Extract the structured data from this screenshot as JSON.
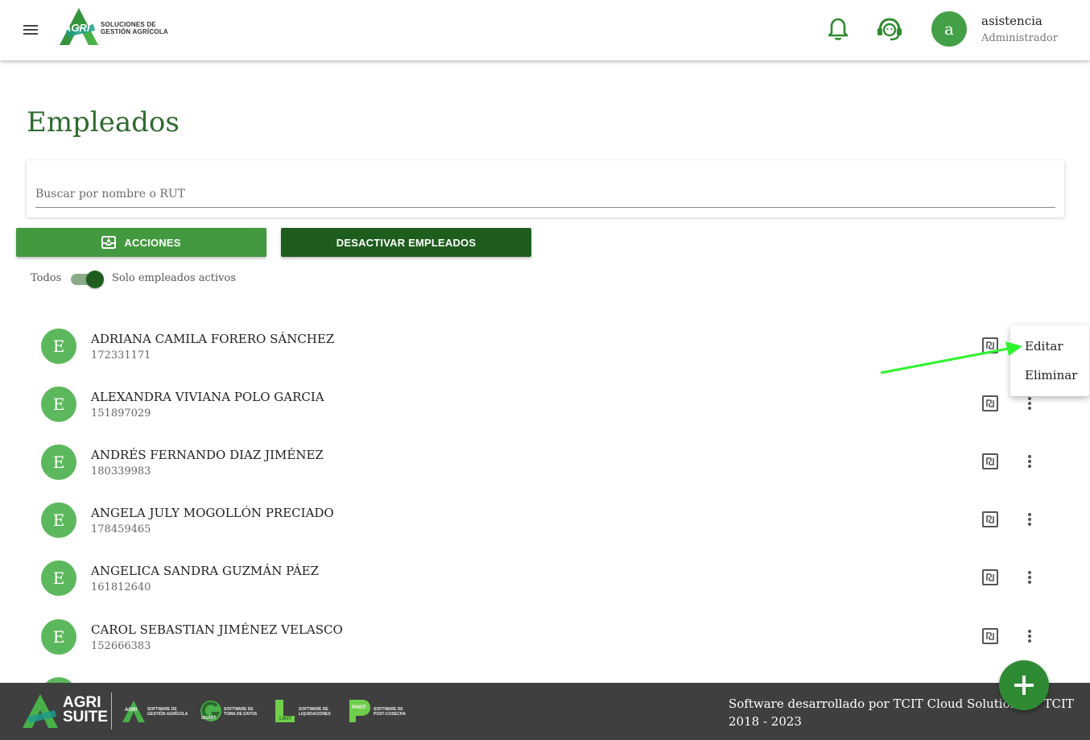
{
  "header": {
    "logo_text": "AGRI",
    "logo_subtitle_line1": "SOLUCIONES DE",
    "logo_subtitle_line2": "GESTIÓN AGRÍCOLA",
    "avatar_letter": "a",
    "user_name": "asistencia",
    "user_role": "Administrador"
  },
  "page": {
    "title": "Empleados"
  },
  "search": {
    "placeholder": "Buscar por nombre o RUT",
    "value": ""
  },
  "buttons": {
    "acciones": "ACCIONES",
    "desactivar": "DESACTIVAR EMPLEADOS"
  },
  "filter": {
    "left_label": "Todos",
    "right_label": "Solo empleados activos",
    "active_only": true
  },
  "employees": [
    {
      "initial": "E",
      "name": "ADRIANA CAMILA FORERO SÁNCHEZ",
      "rut": "172331171"
    },
    {
      "initial": "E",
      "name": "ALEXANDRA VIVIANA POLO GARCIA",
      "rut": "151897029"
    },
    {
      "initial": "E",
      "name": "ANDRÉS FERNANDO DIAZ JIMÉNEZ",
      "rut": "180339983"
    },
    {
      "initial": "E",
      "name": "ANGELA JULY MOGOLLÓN PRECIADO",
      "rut": "178459465"
    },
    {
      "initial": "E",
      "name": "ANGELICA SANDRA GUZMÁN PÁEZ",
      "rut": "161812640"
    },
    {
      "initial": "E",
      "name": "CAROL SEBASTIAN JIMÉNEZ VELASCO",
      "rut": "152666383"
    }
  ],
  "context_menu": {
    "edit": "Editar",
    "delete": "Eliminar"
  },
  "footer": {
    "brand_line1": "AGRI",
    "brand_line2": "SUITE",
    "products": [
      {
        "badge": "AGRI",
        "desc1": "SOFTWARE DE",
        "desc2": "GESTIÓN AGRÍCOLA"
      },
      {
        "badge": "GIVANT",
        "desc1": "SOFTWARE DE",
        "desc2": "TOMA DE DATOS"
      },
      {
        "badge": "LIKIT",
        "desc1": "SOFTWARE DE",
        "desc2": "LIQUIDACIONES"
      },
      {
        "badge": "PAKIT",
        "desc1": "SOFTWARE DE",
        "desc2": "POST-COSECHA"
      }
    ],
    "credit": "Software desarrollado por TCIT Cloud Solutions © TCIT 2018 - 2023"
  },
  "colors": {
    "primary": "#43993f",
    "primary_dark": "#1f5d1f",
    "title": "#2e6b2e",
    "avatar": "#5cb85c",
    "footer_bg": "#3f3f3f",
    "annotation_arrow": "#2ef52e"
  }
}
